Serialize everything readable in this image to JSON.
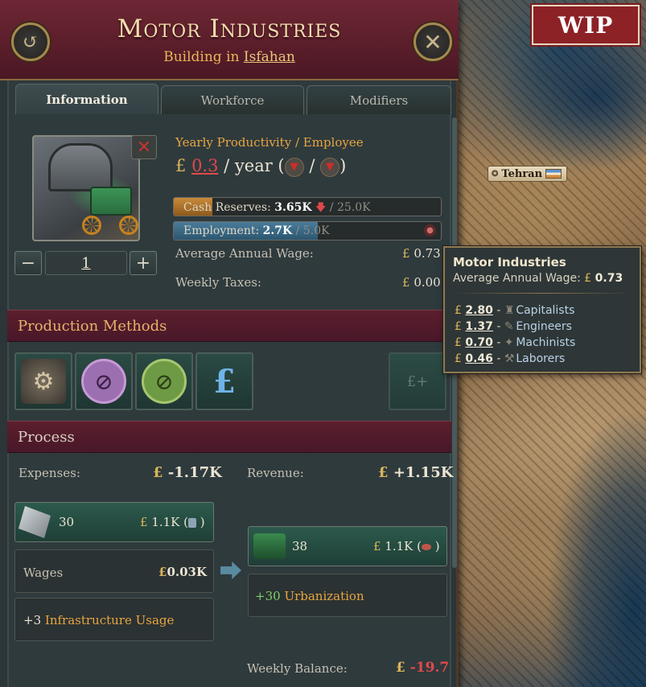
{
  "wip_badge": "WIP",
  "header": {
    "title": "Motor Industries",
    "subtitle_prefix": "Building",
    "subtitle_in": "in",
    "location_link": "Isfahan",
    "back_icon": "back-arrow-icon",
    "close_icon": "close-x-icon"
  },
  "tabs": [
    "Information",
    "Workforce",
    "Modifiers"
  ],
  "info": {
    "productivity_label": "Yearly Productivity / Employee",
    "currency": "£",
    "productivity_value": "0.3",
    "per_year": "/ year (",
    "slash": "/",
    "close_paren": ")",
    "level_value": "1",
    "cash_reserves_label": "Cash Reserves:",
    "cash_reserves_value": "3.65K",
    "cash_reserves_max": "/ 25.0K",
    "cash_fill_fraction": 0.146,
    "employment_label": "Employment:",
    "employment_value": "2.7K",
    "employment_max": "/ 5.0K",
    "employment_fill_fraction": 0.54,
    "avg_wage_label": "Average Annual Wage:",
    "avg_wage_value": "0.73",
    "weekly_taxes_label": "Weekly Taxes:",
    "weekly_taxes_value": "0.00"
  },
  "production_methods": {
    "title": "Production Methods",
    "items": [
      "factory-gears-icon",
      "no-automobile-icon",
      "no-gear-icon",
      "pound-hand-icon"
    ],
    "add_label": "£+"
  },
  "process": {
    "title": "Process",
    "expenses_label": "Expenses:",
    "expenses_value": "-1.17K",
    "revenue_label": "Revenue:",
    "revenue_value": "+1.15K",
    "input": {
      "amount": "30",
      "value": "1.1K",
      "icon": "steel-icon",
      "trend_icon": "barrel-icon"
    },
    "output": {
      "amount": "38",
      "value": "1.1K",
      "icon": "engine-icon",
      "trend_icon": "meat-icon"
    },
    "wages_label": "Wages",
    "wages_value": "0.03K",
    "infra_amount": "+3",
    "infra_label": "Infrastructure Usage",
    "urban_amount": "+30",
    "urban_label": "Urbanization",
    "weekly_balance_label": "Weekly Balance:",
    "weekly_balance_value": "-19.7"
  },
  "tooltip": {
    "title": "Motor Industries",
    "subtitle": "Average Annual Wage:",
    "subtitle_value": "0.73",
    "rows": [
      {
        "value": "2.80",
        "pop": "Capitalists"
      },
      {
        "value": "1.37",
        "pop": "Engineers"
      },
      {
        "value": "0.70",
        "pop": "Machinists"
      },
      {
        "value": "0.46",
        "pop": "Laborers"
      }
    ]
  },
  "map": {
    "city_label": "Tehran"
  }
}
